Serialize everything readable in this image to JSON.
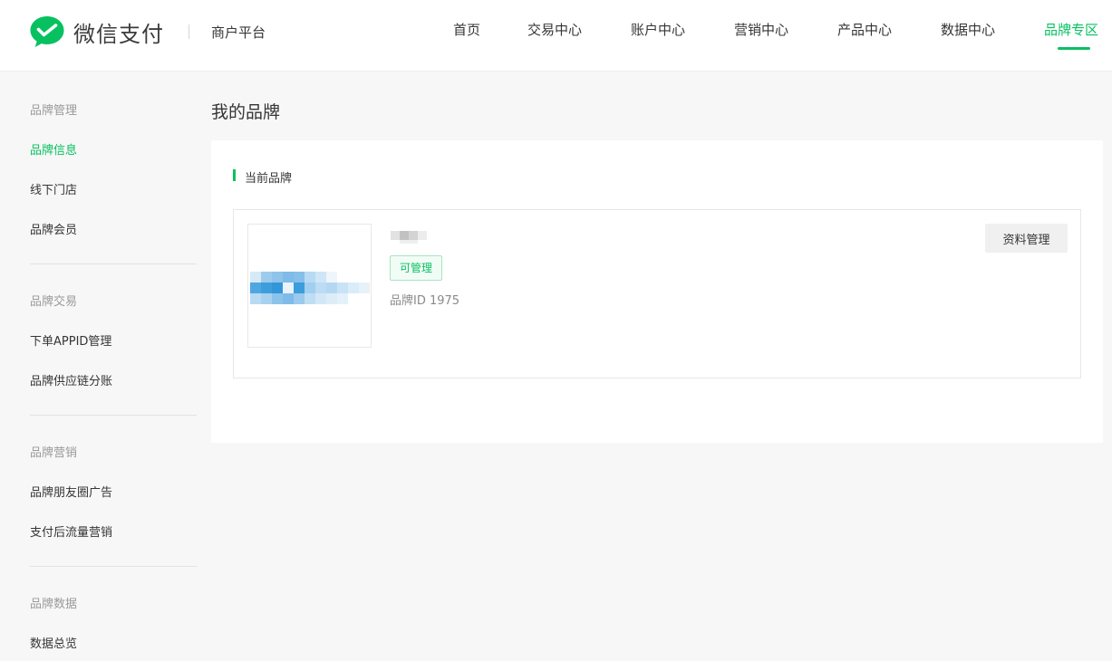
{
  "header": {
    "logo_text": "微信支付",
    "platform_name": "商户平台",
    "brand_color": "#07c160",
    "nav": [
      {
        "label": "首页",
        "active": false
      },
      {
        "label": "交易中心",
        "active": false
      },
      {
        "label": "账户中心",
        "active": false
      },
      {
        "label": "营销中心",
        "active": false
      },
      {
        "label": "产品中心",
        "active": false
      },
      {
        "label": "数据中心",
        "active": false
      },
      {
        "label": "品牌专区",
        "active": true
      }
    ]
  },
  "sidebar": {
    "groups": [
      {
        "title": "品牌管理",
        "items": [
          {
            "label": "品牌信息",
            "active": true
          },
          {
            "label": "线下门店",
            "active": false
          },
          {
            "label": "品牌会员",
            "active": false
          }
        ]
      },
      {
        "title": "品牌交易",
        "items": [
          {
            "label": "下单APPID管理",
            "active": false
          },
          {
            "label": "品牌供应链分账",
            "active": false
          }
        ]
      },
      {
        "title": "品牌营销",
        "items": [
          {
            "label": "品牌朋友圈广告",
            "active": false
          },
          {
            "label": "支付后流量营销",
            "active": false
          }
        ]
      },
      {
        "title": "品牌数据",
        "items": [
          {
            "label": "数据总览",
            "active": false
          }
        ]
      }
    ]
  },
  "main": {
    "page_title": "我的品牌",
    "section_title": "当前品牌",
    "brand": {
      "status_tag": "可管理",
      "brand_id_label": "品牌ID 1975",
      "manage_button": "资料管理"
    }
  },
  "icons": {
    "logo": "wechat-pay-logo-icon"
  }
}
